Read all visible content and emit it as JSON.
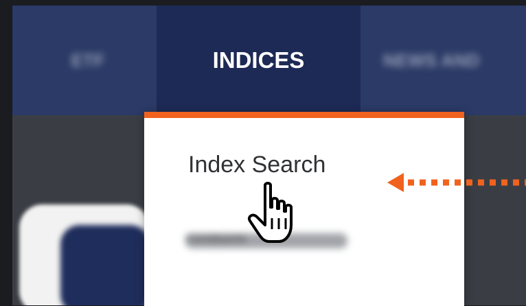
{
  "nav": {
    "items": [
      {
        "label": "ETF"
      },
      {
        "label": "INDICES"
      },
      {
        "label": "NEWS AND"
      }
    ]
  },
  "dropdown": {
    "items": [
      {
        "label": "Index Search"
      },
      {
        "label": "Constituents"
      }
    ]
  },
  "colors": {
    "navbar": "#2b3a66",
    "active_tab": "#1d2a55",
    "accent": "#f0621e",
    "dropdown_bg": "#ffffff"
  },
  "icons": {
    "pointer": "hand-pointer-icon",
    "arrow": "dotted-left-arrow-icon"
  }
}
